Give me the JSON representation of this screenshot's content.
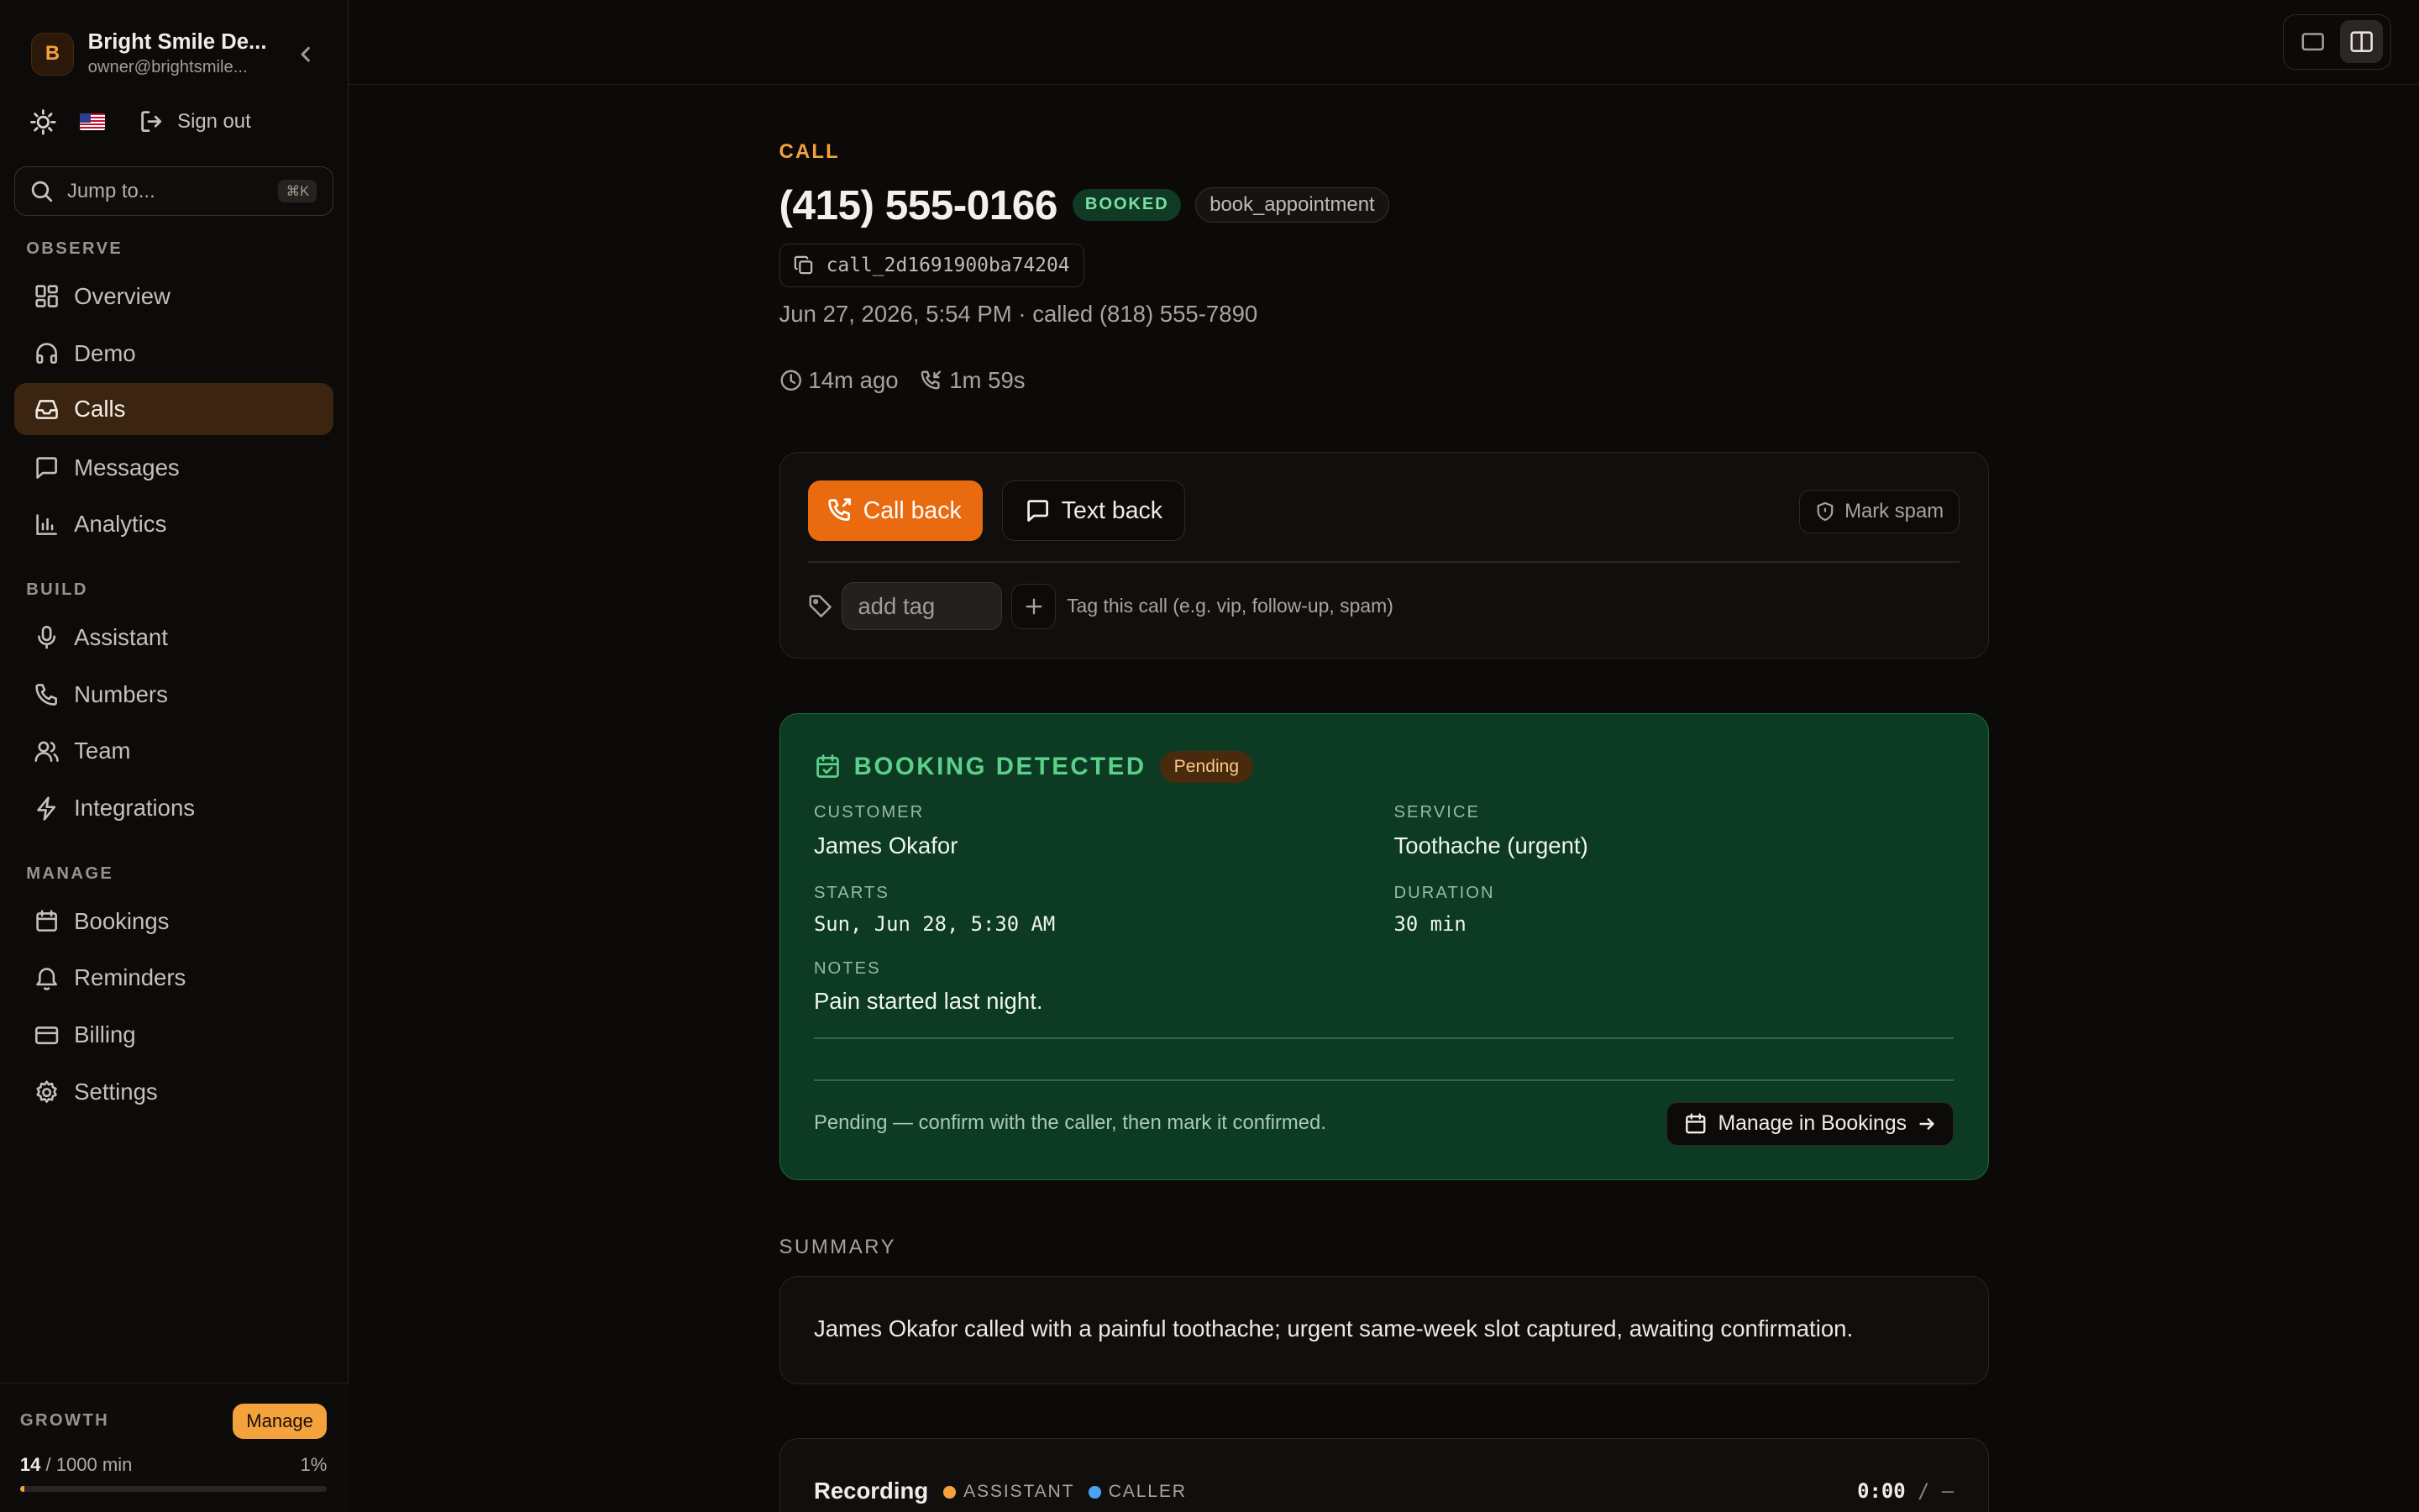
{
  "workspace": {
    "avatar": "B",
    "name": "Bright Smile De...",
    "email": "owner@brightsmile..."
  },
  "topbar": {
    "theme_icon": "sun-icon",
    "locale_flag": "us-flag",
    "signout_label": "Sign out"
  },
  "search": {
    "placeholder": "Jump to...",
    "shortcut": "⌘K"
  },
  "nav": {
    "observe_label": "OBSERVE",
    "build_label": "BUILD",
    "manage_label": "MANAGE",
    "items": [
      {
        "label": "Overview",
        "icon": "grid-icon"
      },
      {
        "label": "Demo",
        "icon": "headphones-icon"
      },
      {
        "label": "Calls",
        "icon": "inbox-icon",
        "active": true
      },
      {
        "label": "Messages",
        "icon": "message-icon"
      },
      {
        "label": "Analytics",
        "icon": "bar-chart-icon"
      },
      {
        "label": "Assistant",
        "icon": "mic-icon"
      },
      {
        "label": "Numbers",
        "icon": "phone-icon"
      },
      {
        "label": "Team",
        "icon": "users-icon"
      },
      {
        "label": "Integrations",
        "icon": "zap-icon"
      },
      {
        "label": "Bookings",
        "icon": "calendar-icon"
      },
      {
        "label": "Reminders",
        "icon": "bell-icon"
      },
      {
        "label": "Billing",
        "icon": "credit-card-icon"
      },
      {
        "label": "Settings",
        "icon": "gear-icon"
      }
    ]
  },
  "plan": {
    "label": "GROWTH",
    "manage_label": "Manage",
    "used": "14",
    "limit_text": "/ 1000 min",
    "percent_text": "1%",
    "usage_fraction": 0.014
  },
  "call": {
    "kicker": "CALL",
    "phone": "(415) 555-0166",
    "status_badge": "BOOKED",
    "intent_tag": "book_appointment",
    "call_id": "call_2d1691900ba74204",
    "meta": "Jun 27, 2026, 5:54 PM · called (818) 555-7890",
    "ago": "14m ago",
    "duration": "1m 59s"
  },
  "actions": {
    "call_back": "Call back",
    "text_back": "Text back",
    "mark_spam": "Mark spam",
    "tag_placeholder": "add tag",
    "tag_hint": "Tag this call (e.g. vip, follow-up, spam)"
  },
  "booking": {
    "title": "BOOKING DETECTED",
    "status": "Pending",
    "customer_label": "CUSTOMER",
    "customer": "James Okafor",
    "service_label": "SERVICE",
    "service": "Toothache (urgent)",
    "starts_label": "STARTS",
    "starts": "Sun, Jun 28, 5:30 AM",
    "duration_label": "DURATION",
    "duration": "30 min",
    "notes_label": "NOTES",
    "notes": "Pain started last night.",
    "footer": "Pending — confirm with the caller, then mark it confirmed.",
    "manage_button": "Manage in Bookings"
  },
  "summary": {
    "label": "SUMMARY",
    "text": "James Okafor called with a painful toothache; urgent same-week slot captured, awaiting confirmation."
  },
  "recording": {
    "title": "Recording",
    "assistant_label": "ASSISTANT",
    "caller_label": "CALLER",
    "current_time": "0:00",
    "total_time": "/ –",
    "colors": {
      "assistant": "#f4a23c",
      "caller": "#4aa3f0"
    }
  },
  "colors": {
    "accent": "#f4a23c",
    "primary_button": "#ea6a10",
    "booking_bg": "#0d3a22",
    "success_text": "#5bd08a"
  }
}
